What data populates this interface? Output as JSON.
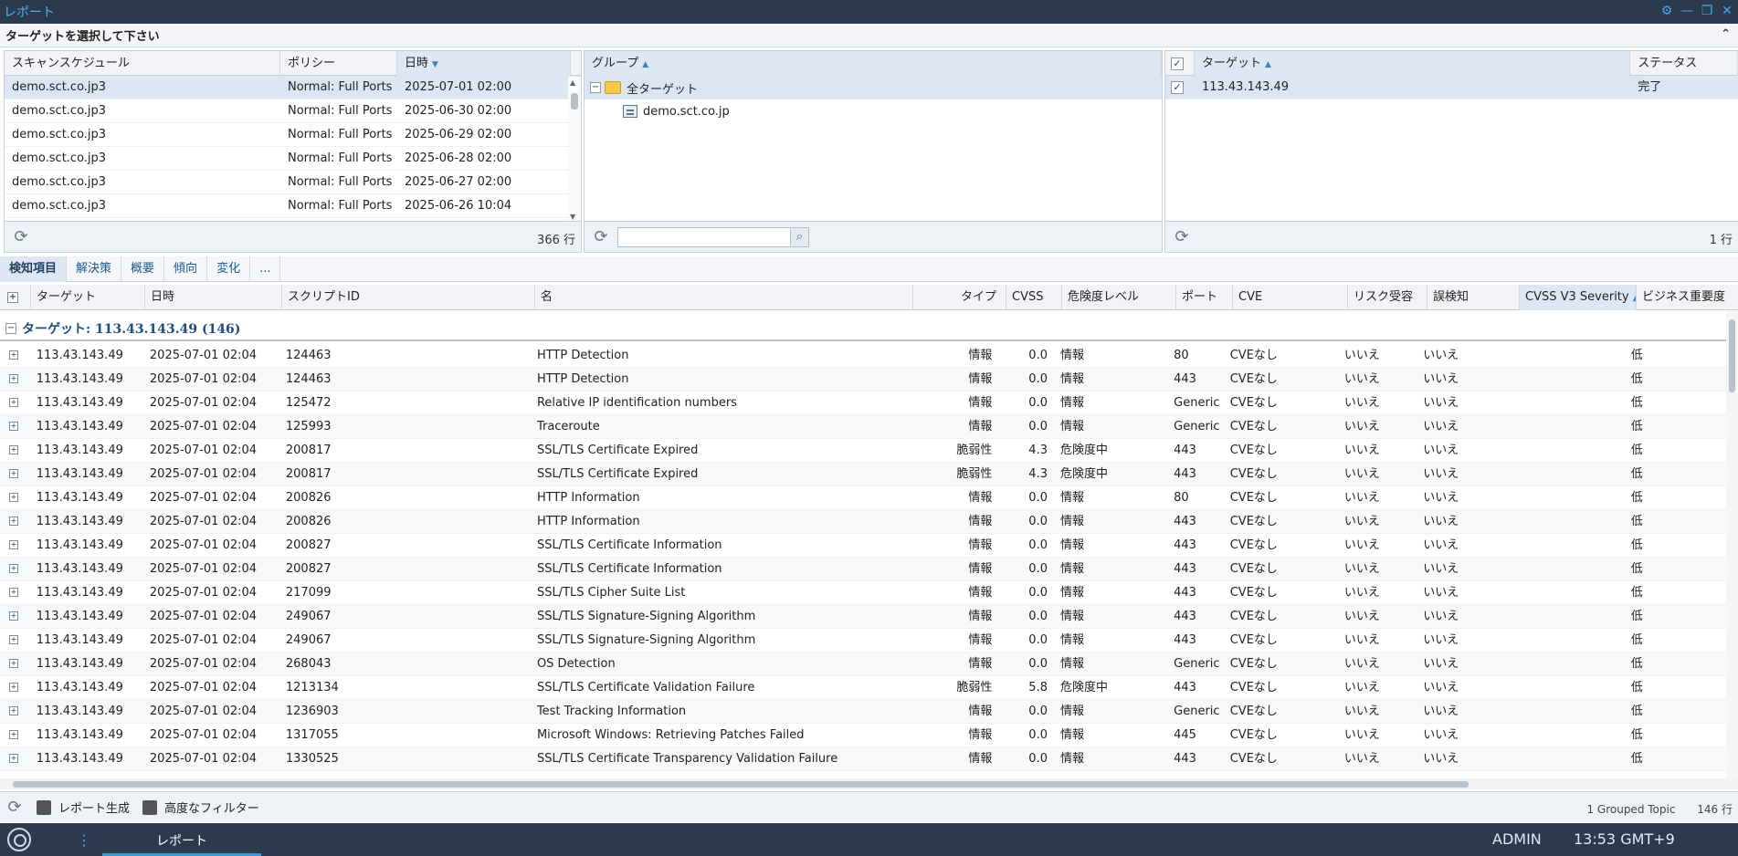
{
  "app": {
    "title": "レポート"
  },
  "target_select": {
    "title": "ターゲットを選択して下さい"
  },
  "schedule_panel": {
    "columns": [
      "スキャンスケジュール",
      "ポリシー",
      "日時"
    ],
    "rows": [
      [
        "demo.sct.co.jp3",
        "Normal: Full Ports",
        "2025-07-01 02:00"
      ],
      [
        "demo.sct.co.jp3",
        "Normal: Full Ports",
        "2025-06-30 02:00"
      ],
      [
        "demo.sct.co.jp3",
        "Normal: Full Ports",
        "2025-06-29 02:00"
      ],
      [
        "demo.sct.co.jp3",
        "Normal: Full Ports",
        "2025-06-28 02:00"
      ],
      [
        "demo.sct.co.jp3",
        "Normal: Full Ports",
        "2025-06-27 02:00"
      ],
      [
        "demo.sct.co.jp3",
        "Normal: Full Ports",
        "2025-06-26 10:04"
      ]
    ],
    "count": "366 行"
  },
  "group_panel": {
    "column": "グループ",
    "root": "全ターゲット",
    "child": "demo.sct.co.jp",
    "search_placeholder": ""
  },
  "target_panel": {
    "columns": [
      "ターゲット",
      "ステータス"
    ],
    "rows": [
      [
        "113.43.143.49",
        "完了"
      ]
    ],
    "count": "1 行"
  },
  "tabs": [
    "検知項目",
    "解決策",
    "概要",
    "傾向",
    "変化",
    "..."
  ],
  "grid": {
    "columns": [
      "ターゲット",
      "日時",
      "スクリプトID",
      "名",
      "タイプ",
      "CVSS",
      "危険度レベル",
      "ポート",
      "CVE",
      "リスク受容",
      "誤検知",
      "CVSS V3 Severity",
      "ビジネス重要度"
    ],
    "group_label": "ターゲット: 113.43.143.49 (146)",
    "rows": [
      [
        "113.43.143.49",
        "2025-07-01 02:04",
        "124463",
        "HTTP Detection",
        "情報",
        "0.0",
        "情報",
        "80",
        "CVEなし",
        "いいえ",
        "いいえ",
        "",
        "低"
      ],
      [
        "113.43.143.49",
        "2025-07-01 02:04",
        "124463",
        "HTTP Detection",
        "情報",
        "0.0",
        "情報",
        "443",
        "CVEなし",
        "いいえ",
        "いいえ",
        "",
        "低"
      ],
      [
        "113.43.143.49",
        "2025-07-01 02:04",
        "125472",
        "Relative IP identification numbers",
        "情報",
        "0.0",
        "情報",
        "Generic",
        "CVEなし",
        "いいえ",
        "いいえ",
        "",
        "低"
      ],
      [
        "113.43.143.49",
        "2025-07-01 02:04",
        "125993",
        "Traceroute",
        "情報",
        "0.0",
        "情報",
        "Generic",
        "CVEなし",
        "いいえ",
        "いいえ",
        "",
        "低"
      ],
      [
        "113.43.143.49",
        "2025-07-01 02:04",
        "200817",
        "SSL/TLS Certificate Expired",
        "脆弱性",
        "4.3",
        "危険度中",
        "443",
        "CVEなし",
        "いいえ",
        "いいえ",
        "",
        "低"
      ],
      [
        "113.43.143.49",
        "2025-07-01 02:04",
        "200817",
        "SSL/TLS Certificate Expired",
        "脆弱性",
        "4.3",
        "危険度中",
        "443",
        "CVEなし",
        "いいえ",
        "いいえ",
        "",
        "低"
      ],
      [
        "113.43.143.49",
        "2025-07-01 02:04",
        "200826",
        "HTTP Information",
        "情報",
        "0.0",
        "情報",
        "80",
        "CVEなし",
        "いいえ",
        "いいえ",
        "",
        "低"
      ],
      [
        "113.43.143.49",
        "2025-07-01 02:04",
        "200826",
        "HTTP Information",
        "情報",
        "0.0",
        "情報",
        "443",
        "CVEなし",
        "いいえ",
        "いいえ",
        "",
        "低"
      ],
      [
        "113.43.143.49",
        "2025-07-01 02:04",
        "200827",
        "SSL/TLS Certificate Information",
        "情報",
        "0.0",
        "情報",
        "443",
        "CVEなし",
        "いいえ",
        "いいえ",
        "",
        "低"
      ],
      [
        "113.43.143.49",
        "2025-07-01 02:04",
        "200827",
        "SSL/TLS Certificate Information",
        "情報",
        "0.0",
        "情報",
        "443",
        "CVEなし",
        "いいえ",
        "いいえ",
        "",
        "低"
      ],
      [
        "113.43.143.49",
        "2025-07-01 02:04",
        "217099",
        "SSL/TLS Cipher Suite List",
        "情報",
        "0.0",
        "情報",
        "443",
        "CVEなし",
        "いいえ",
        "いいえ",
        "",
        "低"
      ],
      [
        "113.43.143.49",
        "2025-07-01 02:04",
        "249067",
        "SSL/TLS Signature-Signing Algorithm",
        "情報",
        "0.0",
        "情報",
        "443",
        "CVEなし",
        "いいえ",
        "いいえ",
        "",
        "低"
      ],
      [
        "113.43.143.49",
        "2025-07-01 02:04",
        "249067",
        "SSL/TLS Signature-Signing Algorithm",
        "情報",
        "0.0",
        "情報",
        "443",
        "CVEなし",
        "いいえ",
        "いいえ",
        "",
        "低"
      ],
      [
        "113.43.143.49",
        "2025-07-01 02:04",
        "268043",
        "OS Detection",
        "情報",
        "0.0",
        "情報",
        "Generic",
        "CVEなし",
        "いいえ",
        "いいえ",
        "",
        "低"
      ],
      [
        "113.43.143.49",
        "2025-07-01 02:04",
        "1213134",
        "SSL/TLS Certificate Validation Failure",
        "脆弱性",
        "5.8",
        "危険度中",
        "443",
        "CVEなし",
        "いいえ",
        "いいえ",
        "",
        "低"
      ],
      [
        "113.43.143.49",
        "2025-07-01 02:04",
        "1236903",
        "Test Tracking Information",
        "情報",
        "0.0",
        "情報",
        "Generic",
        "CVEなし",
        "いいえ",
        "いいえ",
        "",
        "低"
      ],
      [
        "113.43.143.49",
        "2025-07-01 02:04",
        "1317055",
        "Microsoft Windows: Retrieving Patches Failed",
        "情報",
        "0.0",
        "情報",
        "445",
        "CVEなし",
        "いいえ",
        "いいえ",
        "",
        "低"
      ],
      [
        "113.43.143.49",
        "2025-07-01 02:04",
        "1330525",
        "SSL/TLS Certificate Transparency Validation Failure",
        "情報",
        "0.0",
        "情報",
        "443",
        "CVEなし",
        "いいえ",
        "いいえ",
        "",
        "低"
      ]
    ]
  },
  "footer": {
    "report_btn": "レポート生成",
    "filter_btn": "高度なフィルター",
    "grouped": "1 Grouped Topic",
    "count": "146 行"
  },
  "taskbar": {
    "tab": "レポート",
    "user": "ADMIN",
    "time": "13:53 GMT+9"
  }
}
